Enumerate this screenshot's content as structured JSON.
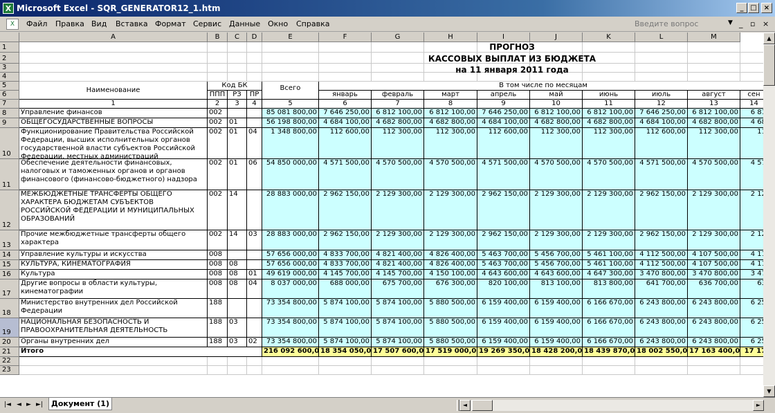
{
  "window": {
    "title": "Microsoft Excel - SQR_GENERATOR12_1.htm",
    "icon": "excel-icon"
  },
  "menu": {
    "items": [
      "Файл",
      "Правка",
      "Вид",
      "Вставка",
      "Формат",
      "Сервис",
      "Данные",
      "Окно",
      "Справка"
    ],
    "ask_placeholder": "Введите вопрос"
  },
  "columns": [
    "A",
    "B",
    "C",
    "D",
    "E",
    "F",
    "G",
    "H",
    "I",
    "J",
    "K",
    "L",
    "M"
  ],
  "rows_numbers": [
    "1",
    "2",
    "3",
    "4",
    "5",
    "6",
    "7",
    "8",
    "9",
    "10",
    "11",
    "12",
    "13",
    "14",
    "15",
    "16",
    "17",
    "18",
    "19",
    "20",
    "21",
    "22",
    "23"
  ],
  "report": {
    "title1": "ПРОГНОЗ",
    "title2": "КАССОВЫХ ВЫПЛАТ ИЗ БЮДЖЕТА",
    "title3": "на 11 января 2011 года",
    "h_name": "Наименование",
    "h_kod": "Код БК",
    "h_ppp": "ППП",
    "h_rz": "РЗ",
    "h_pr": "ПР",
    "h_total": "Всего",
    "h_months": "В том числе по месяцам",
    "months": [
      "январь",
      "февраль",
      "март",
      "апрель",
      "май",
      "июнь",
      "июль",
      "август",
      "сен"
    ],
    "nums": [
      "1",
      "2",
      "3",
      "4",
      "5",
      "6",
      "7",
      "8",
      "9",
      "10",
      "11",
      "12",
      "13",
      "14"
    ]
  },
  "data_rows": [
    {
      "name": "Управление финансов",
      "ppp": "002",
      "rz": "",
      "pr": "",
      "total": "85 081 800,00",
      "m": [
        "7 646 250,00",
        "6 812 100,00",
        "6 812 100,00",
        "7 646 250,00",
        "6 812 100,00",
        "6 812 100,00",
        "7 646 250,00",
        "6 812 100,00",
        "6 81"
      ]
    },
    {
      "name": " ОБЩЕГОСУДАРСТВЕННЫЕ ВОПРОСЫ",
      "ppp": "002",
      "rz": "01",
      "pr": "",
      "total": "56 198 800,00",
      "m": [
        "4 684 100,00",
        "4 682 800,00",
        "4 682 800,00",
        "4 684 100,00",
        "4 682 800,00",
        "4 682 800,00",
        "4 684 100,00",
        "4 682 800,00",
        "4 68"
      ]
    },
    {
      "name": "  Функционирование Правительства Российской Федерации, высших исполнительных органов государственной власти субъектов Российской Федерации, местных администраций",
      "ppp": "002",
      "rz": "01",
      "pr": "04",
      "total": "1 348 800,00",
      "m": [
        "112 600,00",
        "112 300,00",
        "112 300,00",
        "112 600,00",
        "112 300,00",
        "112 300,00",
        "112 600,00",
        "112 300,00",
        "11"
      ]
    },
    {
      "name": "  Обеспечение деятельности финансовых, налоговых и таможенных органов и органов финансового (финансово-бюджетного) надзора",
      "ppp": "002",
      "rz": "01",
      "pr": "06",
      "total": "54 850 000,00",
      "m": [
        "4 571 500,00",
        "4 570 500,00",
        "4 570 500,00",
        "4 571 500,00",
        "4 570 500,00",
        "4 570 500,00",
        "4 571 500,00",
        "4 570 500,00",
        "4 57"
      ]
    },
    {
      "name": " МЕЖБЮДЖЕТНЫЕ ТРАНСФЕРТЫ ОБЩЕГО ХАРАКТЕРА БЮДЖЕТАМ СУБЪЕКТОВ РОССИЙСКОЙ ФЕДЕРАЦИИ И МУНИЦИПАЛЬНЫХ ОБРАЗОВАНИЙ",
      "ppp": "002",
      "rz": "14",
      "pr": "",
      "total": "28 883 000,00",
      "m": [
        "2 962 150,00",
        "2 129 300,00",
        "2 129 300,00",
        "2 962 150,00",
        "2 129 300,00",
        "2 129 300,00",
        "2 962 150,00",
        "2 129 300,00",
        "2 12"
      ]
    },
    {
      "name": "  Прочие межбюджетные трансферты общего характера",
      "ppp": "002",
      "rz": "14",
      "pr": "03",
      "total": "28 883 000,00",
      "m": [
        "2 962 150,00",
        "2 129 300,00",
        "2 129 300,00",
        "2 962 150,00",
        "2 129 300,00",
        "2 129 300,00",
        "2 962 150,00",
        "2 129 300,00",
        "2 12"
      ]
    },
    {
      "name": "Управление культуры и искусства",
      "ppp": "008",
      "rz": "",
      "pr": "",
      "total": "57 656 000,00",
      "m": [
        "4 833 700,00",
        "4 821 400,00",
        "4 826 400,00",
        "5 463 700,00",
        "5 456 700,00",
        "5 461 100,00",
        "4 112 500,00",
        "4 107 500,00",
        "4 11"
      ]
    },
    {
      "name": " КУЛЬТУРА, КИНЕМАТОГРАФИЯ",
      "ppp": "008",
      "rz": "08",
      "pr": "",
      "total": "57 656 000,00",
      "m": [
        "4 833 700,00",
        "4 821 400,00",
        "4 826 400,00",
        "5 463 700,00",
        "5 456 700,00",
        "5 461 100,00",
        "4 112 500,00",
        "4 107 500,00",
        "4 11"
      ]
    },
    {
      "name": "  Культура",
      "ppp": "008",
      "rz": "08",
      "pr": "01",
      "total": "49 619 000,00",
      "m": [
        "4 145 700,00",
        "4 145 700,00",
        "4 150 100,00",
        "4 643 600,00",
        "4 643 600,00",
        "4 647 300,00",
        "3 470 800,00",
        "3 470 800,00",
        "3 47"
      ]
    },
    {
      "name": "  Другие вопросы в области культуры, кинематографии",
      "ppp": "008",
      "rz": "08",
      "pr": "04",
      "total": "8 037 000,00",
      "m": [
        "688 000,00",
        "675 700,00",
        "676 300,00",
        "820 100,00",
        "813 100,00",
        "813 800,00",
        "641 700,00",
        "636 700,00",
        "63"
      ]
    },
    {
      "name": "Министерство внутренних дел Российской Федерации",
      "ppp": "188",
      "rz": "",
      "pr": "",
      "total": "73 354 800,00",
      "m": [
        "5 874 100,00",
        "5 874 100,00",
        "5 880 500,00",
        "6 159 400,00",
        "6 159 400,00",
        "6 166 670,00",
        "6 243 800,00",
        "6 243 800,00",
        "6 25"
      ]
    },
    {
      "name": " НАЦИОНАЛЬНАЯ БЕЗОПАСНОСТЬ И ПРАВООХРАНИТЕЛЬНАЯ ДЕЯТЕЛЬНОСТЬ",
      "ppp": "188",
      "rz": "03",
      "pr": "",
      "total": "73 354 800,00",
      "m": [
        "5 874 100,00",
        "5 874 100,00",
        "5 880 500,00",
        "6 159 400,00",
        "6 159 400,00",
        "6 166 670,00",
        "6 243 800,00",
        "6 243 800,00",
        "6 25"
      ]
    },
    {
      "name": "  Органы внутренних дел",
      "ppp": "188",
      "rz": "03",
      "pr": "02",
      "total": "73 354 800,00",
      "m": [
        "5 874 100,00",
        "5 874 100,00",
        "5 880 500,00",
        "6 159 400,00",
        "6 159 400,00",
        "6 166 670,00",
        "6 243 800,00",
        "6 243 800,00",
        "6 25"
      ]
    }
  ],
  "total_row": {
    "name": "Итого",
    "total": "216 092 600,00",
    "m": [
      "18 354 050,00",
      "17 507 600,00",
      "17 519 000,00",
      "19 269 350,00",
      "18 428 200,00",
      "18 439 870,00",
      "18 002 550,00",
      "17 163 400,00",
      "17 17"
    ]
  },
  "sheet_tab": "Документ (1)",
  "colors": {
    "highlight": "#ccffff",
    "total": "#ffff99",
    "titlebar": "#0a246a"
  }
}
